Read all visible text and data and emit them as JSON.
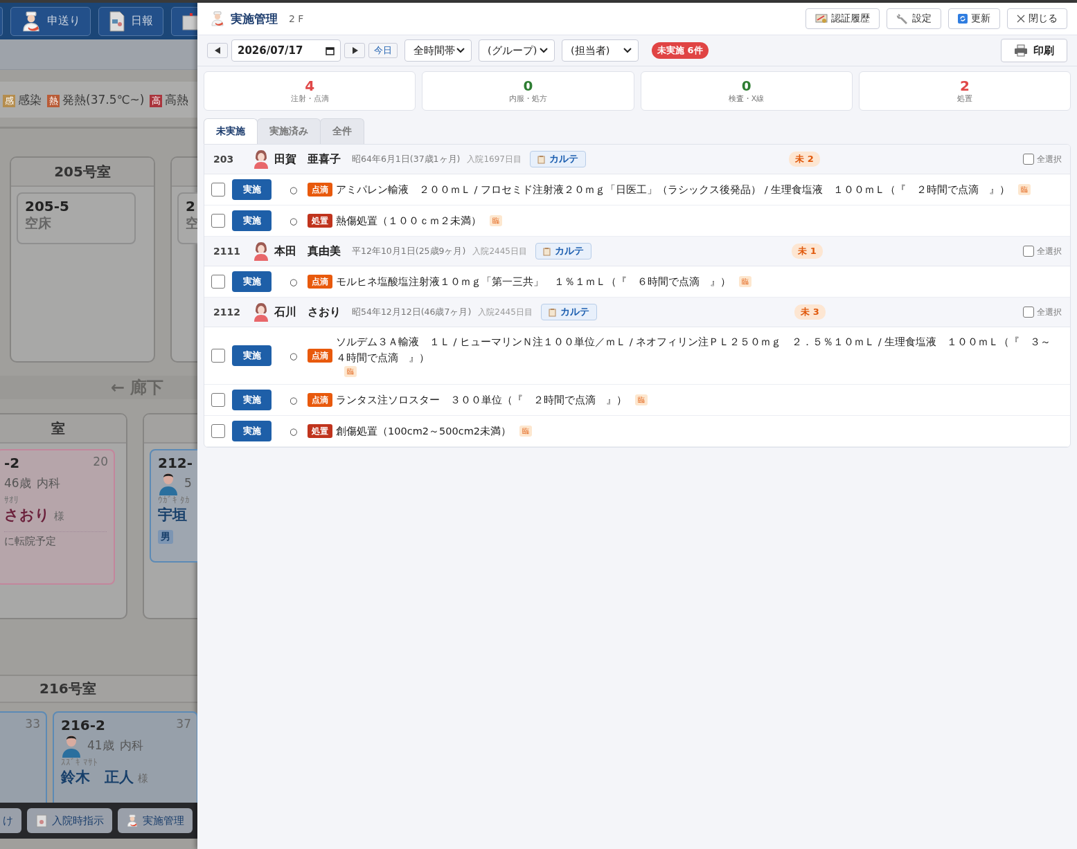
{
  "background": {
    "nav_buttons": [
      "申送り",
      "日報"
    ],
    "legend": [
      {
        "tag": "感",
        "label": "感染",
        "color": "#b58d4e"
      },
      {
        "tag": "熱",
        "label": "発熱(37.5℃~)",
        "color": "#b95b36"
      },
      {
        "tag": "高",
        "label": "高熱",
        "color": "#a9343c"
      }
    ],
    "upper_rooms": [
      {
        "title": "205号室",
        "beds": [
          {
            "kind": "empty",
            "bed": "205-5",
            "status": "空床"
          }
        ]
      },
      {
        "beds": [
          {
            "kind": "empty",
            "bed": "2",
            "status": "空"
          }
        ]
      }
    ],
    "corridor": "← 廊下",
    "lower_rooms": [
      {
        "title": "室",
        "beds": [
          {
            "kind": "female",
            "bed": "-2",
            "number": "20",
            "age": "46歳",
            "dept": "内科",
            "kana": "ｻｵﾘ",
            "name": "さおり",
            "honorific": "様",
            "note": "に転院予定"
          }
        ]
      },
      {
        "beds": [
          {
            "kind": "male",
            "bed": "212-",
            "age": "5",
            "kana": "ｳｶﾞｷ ﾀｶ",
            "name": "宇垣",
            "sex": "男"
          }
        ]
      }
    ],
    "bottom_room": {
      "title": "216号室",
      "beds": [
        {
          "kind": "none",
          "number": "33"
        },
        {
          "kind": "male",
          "bed": "216-2",
          "number": "37",
          "age": "41歳",
          "dept": "内科",
          "kana": "ｽｽﾞｷ ﾏｻﾄ",
          "name": "鈴木　正人",
          "honorific": "様"
        }
      ]
    },
    "dock_buttons": [
      "け",
      "入院時指示",
      "実施管理"
    ]
  },
  "panel": {
    "title": "実施管理",
    "floor": "2 F",
    "buttons": [
      "認証履歴",
      "設定",
      "更新",
      "閉じる"
    ],
    "toolbar": {
      "date": "2026/07/17",
      "today": "今日",
      "selects": [
        "全時間帯",
        "(グループ)",
        "(担当者)"
      ],
      "badge": "未実施 6件",
      "print": "印刷"
    },
    "summary": [
      {
        "count": "4",
        "label": "注射・点滴",
        "color": "#e04848"
      },
      {
        "count": "0",
        "label": "内服・処方",
        "color": "#2e7d32"
      },
      {
        "count": "0",
        "label": "検査・X線",
        "color": "#2e7d32"
      },
      {
        "count": "2",
        "label": "処置",
        "color": "#e04848"
      }
    ],
    "tabs": [
      {
        "label": "未実施",
        "selected": true
      },
      {
        "label": "実施済み",
        "selected": false
      },
      {
        "label": "全件",
        "selected": false
      }
    ],
    "patients": [
      {
        "room": "203",
        "name": "田賀　亜喜子",
        "birth": "昭64年6月1日(37歳1ヶ月)",
        "admitted": "入院1697日目",
        "chart": "カルテ",
        "pending": "未 2",
        "select_all": "全選択",
        "all_checked": false,
        "orders": [
          {
            "checked": false,
            "button": "実施",
            "mark": "○",
            "kind": "drip",
            "category": "点滴",
            "text": "アミパレン輸液　２００ｍＬ / フロセミド注射液２０ｍｇ「日医工」（ラシックス後発品） / 生理食塩液　１００ｍＬ（『　２時間で点滴　』）",
            "tag": "臨"
          },
          {
            "checked": false,
            "button": "実施",
            "mark": "○",
            "kind": "treatment",
            "category": "処置",
            "text": "熱傷処置（１００ｃｍ２未満）",
            "tag": "臨"
          }
        ]
      },
      {
        "room": "2111",
        "name": "本田　真由美",
        "birth": "平12年10月1日(25歳9ヶ月)",
        "admitted": "入院2445日目",
        "chart": "カルテ",
        "pending": "未 1",
        "select_all": "全選択",
        "all_checked": false,
        "orders": [
          {
            "checked": false,
            "button": "実施",
            "mark": "○",
            "kind": "drip",
            "category": "点滴",
            "text": "モルヒネ塩酸塩注射液１０ｍｇ「第一三共」　１％１ｍＬ（『　６時間で点滴　』）",
            "tag": "臨"
          }
        ]
      },
      {
        "room": "2112",
        "name": "石川　さおり",
        "birth": "昭54年12月12日(46歳7ヶ月)",
        "admitted": "入院2445日目",
        "chart": "カルテ",
        "pending": "未 3",
        "select_all": "全選択",
        "all_checked": false,
        "orders": [
          {
            "checked": false,
            "button": "実施",
            "mark": "○",
            "kind": "drip",
            "category": "点滴",
            "text": "ソルデム３Ａ輸液　１Ｌ / ヒューマリンＮ注１００単位／ｍＬ / ネオフィリン注ＰＬ２５０ｍｇ　２．５％１０ｍＬ / 生理食塩液　１００ｍＬ（『　３～４時間で点滴　』）",
            "tag": "臨"
          },
          {
            "checked": false,
            "button": "実施",
            "mark": "○",
            "kind": "drip",
            "category": "点滴",
            "text": "ランタス注ソロスター　３００単位（『　２時間で点滴　』）",
            "tag": "臨"
          },
          {
            "checked": false,
            "button": "実施",
            "mark": "○",
            "kind": "treatment",
            "category": "処置",
            "text": "創傷処置（100cm2～500cm2未満）",
            "tag": "臨"
          }
        ]
      }
    ]
  }
}
